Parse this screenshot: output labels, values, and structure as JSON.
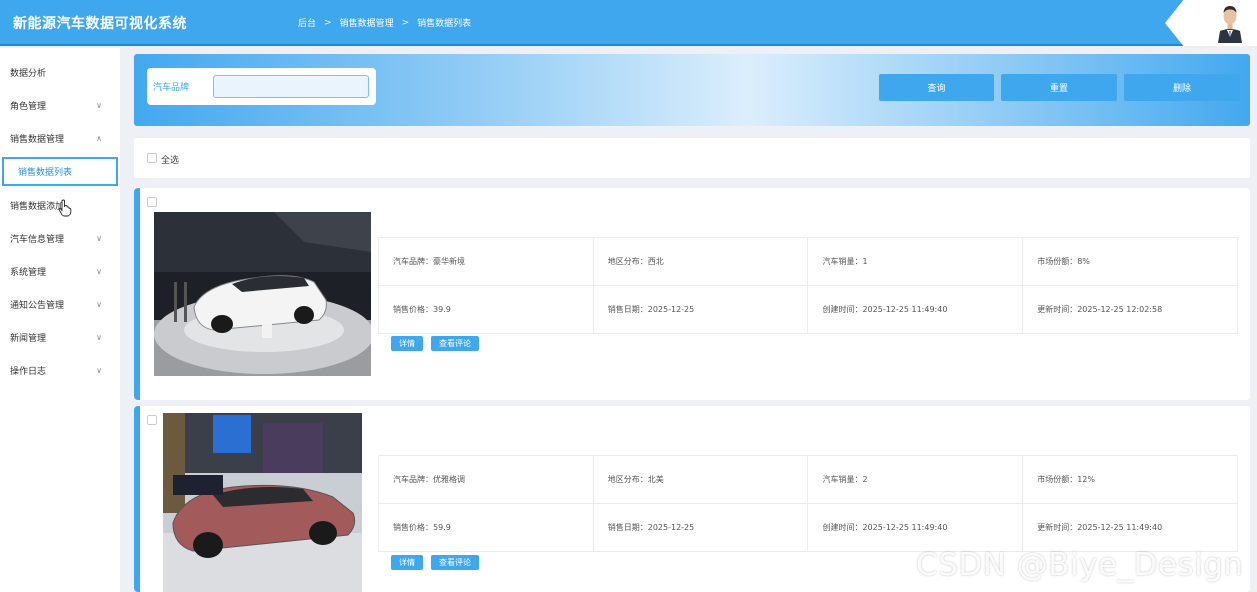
{
  "header": {
    "app_title": "新能源汽车数据可视化系统",
    "breadcrumb": [
      "后台",
      "销售数据管理",
      "销售数据列表"
    ]
  },
  "sidebar": {
    "items": [
      {
        "label": "数据分析",
        "chevron": ""
      },
      {
        "label": "角色管理",
        "chevron": "∨"
      },
      {
        "label": "销售数据管理",
        "chevron": "∧"
      },
      {
        "label": "销售数据列表",
        "chevron": ""
      },
      {
        "label": "销售数据添加",
        "chevron": ""
      },
      {
        "label": "汽车信息管理",
        "chevron": "∨"
      },
      {
        "label": "系统管理",
        "chevron": "∨"
      },
      {
        "label": "通知公告管理",
        "chevron": "∨"
      },
      {
        "label": "新闻管理",
        "chevron": "∨"
      },
      {
        "label": "操作日志",
        "chevron": "∨"
      }
    ]
  },
  "search": {
    "label": "汽车品牌",
    "value": "",
    "buttons": {
      "query": "查询",
      "reset": "重置",
      "delete": "删除"
    }
  },
  "select_all_label": "全选",
  "records": [
    {
      "cells": [
        "汽车品牌：豪华新境",
        "地区分布：西北",
        "汽车销量：1",
        "市场份额：8%",
        "销售价格：39.9",
        "销售日期：2025-12-25",
        "创建时间：2025-12-25 11:49:40",
        "更新时间：2025-12-25 12:02:58"
      ],
      "detail_label": "详情",
      "comments_label": "查看评论",
      "car_color": "#f4f4f4"
    },
    {
      "cells": [
        "汽车品牌：优雅格调",
        "地区分布：北美",
        "汽车销量：2",
        "市场份额：12%",
        "销售价格：59.9",
        "销售日期：2025-12-25",
        "创建时间：2025-12-25 11:49:40",
        "更新时间：2025-12-25 11:49:40"
      ],
      "detail_label": "详情",
      "comments_label": "查看评论",
      "car_color": "#a35a5a"
    }
  ],
  "watermark": "CSDN @Biye_Design",
  "colors": {
    "accent": "#3fa7ee"
  }
}
